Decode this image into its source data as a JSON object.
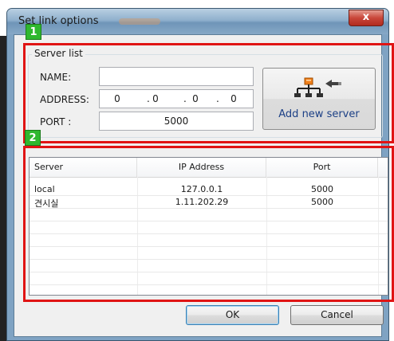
{
  "window": {
    "title": "Set link options",
    "close_glyph": "x"
  },
  "badges": {
    "first": "1",
    "second": "2"
  },
  "server_list": {
    "group_title": "Server list",
    "name_label": "NAME:",
    "address_label": "ADDRESS:",
    "port_label": "PORT :",
    "name_value": "",
    "address_octets": [
      "0",
      "0",
      "0",
      "0"
    ],
    "address_separator": ".",
    "port_value": "5000",
    "add_button_label": "Add new server",
    "add_button_icon": "network-add-icon"
  },
  "table": {
    "columns": [
      "Server",
      "IP Address",
      "Port"
    ],
    "rows": [
      {
        "server": "local",
        "ip": "127.0.0.1",
        "port": "5000"
      },
      {
        "server": "견시실",
        "ip": "1.11.202.29",
        "port": "5000"
      }
    ]
  },
  "buttons": {
    "ok": "OK",
    "cancel": "Cancel"
  },
  "colors": {
    "highlight": "#e01414",
    "badge": "#2fb82f",
    "close_button": "#c9473a",
    "add_button_text": "#1b3f85"
  }
}
